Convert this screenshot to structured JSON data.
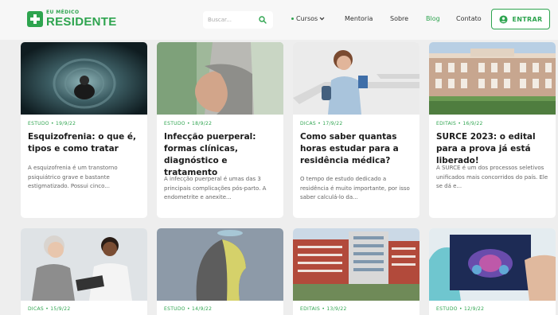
{
  "header": {
    "logo_small": "EU MÉDICO",
    "logo_big": "RESIDENTE",
    "search_placeholder": "Buscar...",
    "nav": {
      "cursos": "Cursos",
      "mentoria": "Mentoria",
      "sobre": "Sobre",
      "blog": "Blog",
      "contato": "Contato"
    },
    "login_label": "ENTRAR"
  },
  "colors": {
    "brand": "#2ea44f",
    "background": "#eeeeee",
    "card": "#ffffff"
  },
  "posts": [
    {
      "meta": "ESTUDO • 19/9/22",
      "title": "Esquizofrenia: o que é, tipos e como tratar",
      "excerpt": "A esquizofrenia é um transtorno psiquiátrico grave e bastante estigmatizado. Possui cinco...",
      "image": "person-in-dark-tunnel-photo"
    },
    {
      "meta": "ESTUDO • 18/9/22",
      "title": "Infecção puerperal: formas clínicas, diagnóstico e tratamento",
      "excerpt": "A infecção puerperal é umas das 3 principais complicações pós-parto. A endometrite e anexite...",
      "image": "pregnant-belly-photo"
    },
    {
      "meta": "DICAS • 17/9/22",
      "title": "Como saber quantas horas estudar para a residência médica?",
      "excerpt": "O tempo de estudo dedicado a residência é muito importante, por isso saber calculá-lo da...",
      "image": "student-on-stairs-photo"
    },
    {
      "meta": "EDITAIS • 16/9/22",
      "title": "SURCE 2023: o edital para a prova já está liberado!",
      "excerpt": "A SURCE é um dos processos seletivos unificados mais concorridos do país. Ele se dá e...",
      "image": "hospital-building-photo"
    },
    {
      "meta": "DICAS • 15/9/22",
      "image": "doctor-with-patient-photo"
    },
    {
      "meta": "ESTUDO • 14/9/22",
      "image": "head-silhouette-photo"
    },
    {
      "meta": "EDITAIS • 13/9/22",
      "image": "hospital-facade-photo"
    },
    {
      "meta": "ESTUDO • 12/9/22",
      "image": "pelvis-xray-photo"
    }
  ]
}
